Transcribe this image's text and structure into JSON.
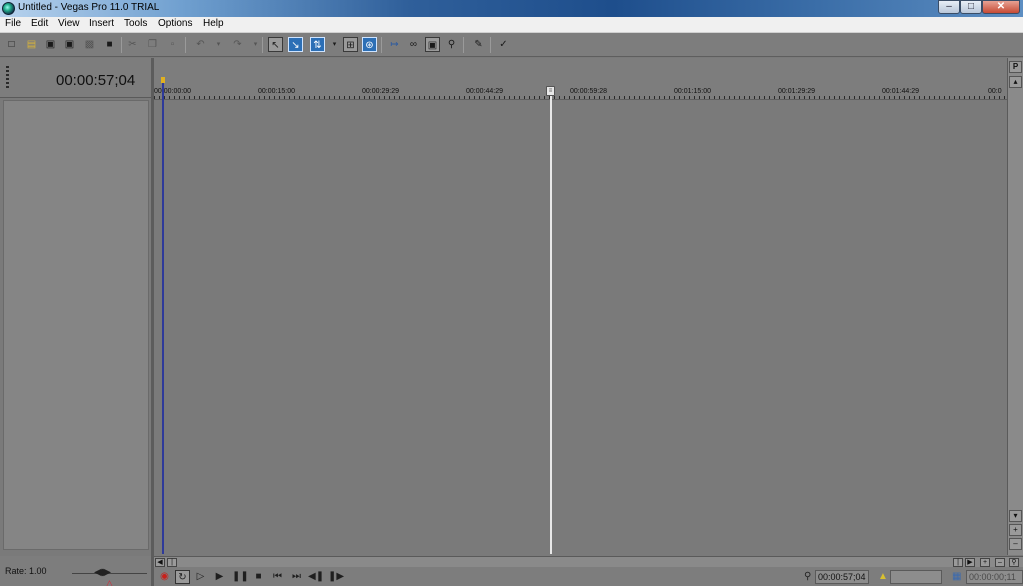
{
  "window": {
    "title": "Untitled - Vegas Pro 11.0 TRIAL",
    "controls": {
      "minimize": "–",
      "maximize": "□",
      "close": "✕"
    }
  },
  "menu": [
    "File",
    "Edit",
    "View",
    "Insert",
    "Tools",
    "Options",
    "Help"
  ],
  "toolbar": {
    "icons": [
      "new-icon",
      "open-icon",
      "save-icon",
      "save-as-icon",
      "render-icon",
      "properties-icon",
      "cut-icon",
      "copy-icon",
      "paste-icon",
      "undo-icon",
      "redo-icon",
      "normal-edit-tool-icon",
      "envelope-edit-tool-icon",
      "selection-edit-tool-icon",
      "snapping-icon",
      "auto-ripple-icon",
      "enable-snapping-icon",
      "zoom-icon",
      "ignore-event-grouping-icon",
      "lock-envelopes-icon",
      "auto-crossfade-icon",
      "split-icon",
      "what-is-this-icon"
    ]
  },
  "left_panel": {
    "cursor_time": "00:00:57;04",
    "rate": "Rate: 1.00"
  },
  "ruler": {
    "labels": [
      "00:00:00:00",
      "00:00:15:00",
      "00:00:29:29",
      "00:00:44:29",
      "00:00:59:28",
      "00:01:15:00",
      "00:01:29:29",
      "00:01:44:29",
      "00:0"
    ]
  },
  "transport": {
    "cursor_position": "00:00:57;04",
    "selection_length": "",
    "length_readout": "00:00:00;11",
    "icons": [
      "record-icon",
      "loop-playback-icon",
      "play-from-start-icon",
      "play-icon",
      "pause-icon",
      "stop-icon",
      "go-to-start-icon",
      "go-to-end-icon",
      "previous-frame-icon",
      "next-frame-icon"
    ]
  },
  "vscroll": {
    "top_button": "P"
  },
  "colors": {
    "timeline_bg": "#7a7a7a",
    "start_marker": "#2e3a9a",
    "cursor": "#e8e8e8",
    "record": "#c8201a"
  }
}
